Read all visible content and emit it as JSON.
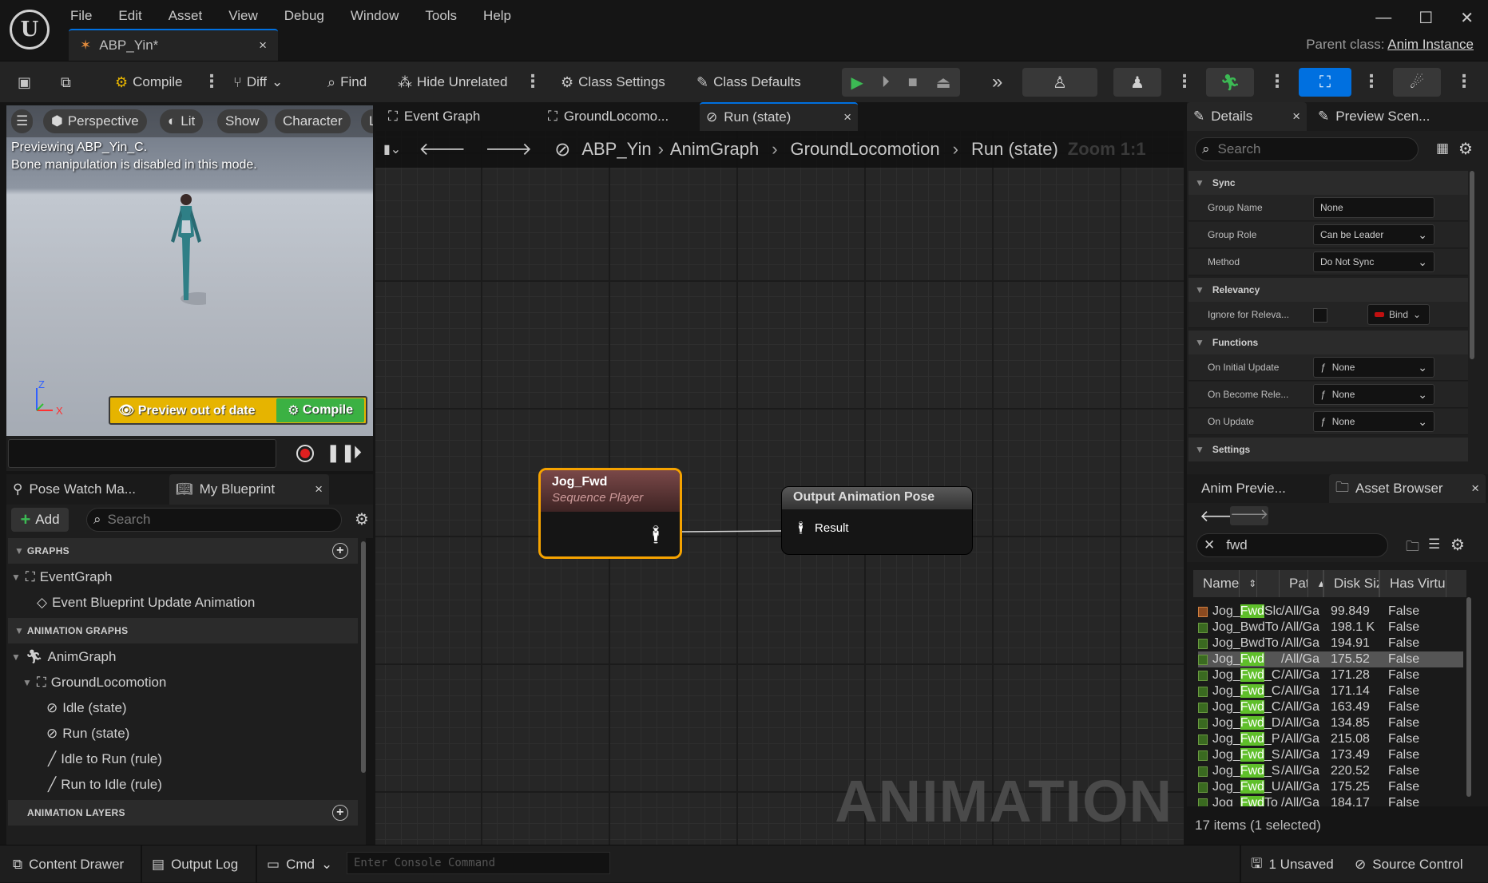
{
  "menu": [
    "File",
    "Edit",
    "Asset",
    "View",
    "Debug",
    "Window",
    "Tools",
    "Help"
  ],
  "doc_tab": {
    "title": "ABP_Yin*",
    "close": "×"
  },
  "window_controls": {
    "minimize": "—",
    "maximize": "☐",
    "close": "✕"
  },
  "parent_class": {
    "label": "Parent class:",
    "value": "Anim Instance"
  },
  "toolbar": {
    "compile": "Compile",
    "diff": "Diff",
    "find": "Find",
    "hide_unrelated": "Hide Unrelated",
    "class_settings": "Class Settings",
    "class_defaults": "Class Defaults"
  },
  "viewport": {
    "buttons": [
      "Perspective",
      "Lit",
      "Show",
      "Character",
      "L"
    ],
    "message_line1": "Previewing ABP_Yin_C.",
    "message_line2": "Bone manipulation is disabled in this mode.",
    "warning": "Preview out of date",
    "compile": "Compile",
    "axis_z": "Z",
    "axis_x": "X"
  },
  "left_panel": {
    "tab_pose_watch": "Pose Watch Ma...",
    "tab_my_blueprint": "My Blueprint",
    "add": "Add",
    "search_placeholder": "Search",
    "sections": {
      "graphs": "GRAPHS",
      "animation_graphs": "ANIMATION GRAPHS",
      "animation_layers": "ANIMATION LAYERS"
    },
    "tree": {
      "event_graph": "EventGraph",
      "event_bp_update": "Event Blueprint Update Animation",
      "anim_graph": "AnimGraph",
      "ground_locomotion": "GroundLocomotion",
      "idle_state": "Idle (state)",
      "run_state": "Run (state)",
      "idle_to_run": "Idle to Run (rule)",
      "run_to_idle": "Run to Idle (rule)"
    }
  },
  "graph": {
    "tabs": [
      "Event Graph",
      "GroundLocomo...",
      "Run (state)"
    ],
    "breadcrumb": [
      "ABP_Yin",
      "AnimGraph",
      "GroundLocomotion",
      "Run (state)"
    ],
    "zoom": "Zoom 1:1",
    "watermark": "ANIMATION",
    "node_player": {
      "title": "Jog_Fwd",
      "subtitle": "Sequence Player"
    },
    "node_output": {
      "title": "Output Animation Pose",
      "pin": "Result"
    }
  },
  "details": {
    "tab_details": "Details",
    "tab_preview": "Preview Scen...",
    "search_placeholder": "Search",
    "sync": {
      "title": "Sync",
      "group_name_label": "Group Name",
      "group_name": "None",
      "group_role_label": "Group Role",
      "group_role": "Can be Leader",
      "method_label": "Method",
      "method": "Do Not Sync"
    },
    "relevancy": {
      "title": "Relevancy",
      "ignore_label": "Ignore for Releva...",
      "bind": "Bind"
    },
    "functions": {
      "title": "Functions",
      "initial_label": "On Initial Update",
      "initial": "None",
      "become_label": "On Become Rele...",
      "become": "None",
      "update_label": "On Update",
      "update": "None"
    },
    "settings": {
      "title": "Settings"
    }
  },
  "asset_browser": {
    "tab_anim_preview": "Anim Previe...",
    "tab_asset_browser": "Asset Browser",
    "search_value": "fwd",
    "columns": [
      "Name",
      "Path",
      "Disk Size",
      "Has Virtu"
    ],
    "rows": [
      {
        "pre": "Jog_",
        "hl": "Fwd",
        "post": "Slo|",
        "path": "/All/Ga",
        "size": "99.849",
        "virt": "False",
        "icon": "orange"
      },
      {
        "pre": "Jog_BwdTo",
        "hl": "",
        "post": "",
        "path": "/All/Ga",
        "size": "198.1 K",
        "virt": "False",
        "icon": "green"
      },
      {
        "pre": "Jog_BwdTo",
        "hl": "",
        "post": "",
        "path": "/All/Ga",
        "size": "194.91",
        "virt": "False",
        "icon": "green"
      },
      {
        "pre": "Jog_",
        "hl": "Fwd",
        "post": "",
        "path": "/All/Ga",
        "size": "175.52",
        "virt": "False",
        "icon": "green",
        "selected": true
      },
      {
        "pre": "Jog_",
        "hl": "Fwd",
        "post": "_C",
        "path": "/All/Ga",
        "size": "171.28",
        "virt": "False",
        "icon": "green"
      },
      {
        "pre": "Jog_",
        "hl": "Fwd",
        "post": "_C",
        "path": "/All/Ga",
        "size": "171.14",
        "virt": "False",
        "icon": "green"
      },
      {
        "pre": "Jog_",
        "hl": "Fwd",
        "post": "_C",
        "path": "/All/Ga",
        "size": "163.49",
        "virt": "False",
        "icon": "green"
      },
      {
        "pre": "Jog_",
        "hl": "Fwd",
        "post": "_D",
        "path": "/All/Ga",
        "size": "134.85",
        "virt": "False",
        "icon": "green"
      },
      {
        "pre": "Jog_",
        "hl": "Fwd",
        "post": "_P",
        "path": "/All/Ga",
        "size": "215.08",
        "virt": "False",
        "icon": "green"
      },
      {
        "pre": "Jog_",
        "hl": "Fwd",
        "post": "_S",
        "path": "/All/Ga",
        "size": "173.49",
        "virt": "False",
        "icon": "green"
      },
      {
        "pre": "Jog_",
        "hl": "Fwd",
        "post": "_S",
        "path": "/All/Ga",
        "size": "220.52",
        "virt": "False",
        "icon": "green"
      },
      {
        "pre": "Jog_",
        "hl": "Fwd",
        "post": "_U",
        "path": "/All/Ga",
        "size": "175.25",
        "virt": "False",
        "icon": "green"
      },
      {
        "pre": "Jog_",
        "hl": "Fwd",
        "post": "To",
        "path": "/All/Ga",
        "size": "184.17",
        "virt": "False",
        "icon": "green"
      }
    ],
    "count": "17 items (1 selected)"
  },
  "statusbar": {
    "content_drawer": "Content Drawer",
    "output_log": "Output Log",
    "cmd": "Cmd",
    "console_placeholder": "Enter Console Command",
    "unsaved": "1 Unsaved",
    "source_control": "Source Control"
  },
  "colors": {
    "accent": "#0070e0",
    "node_border": "#f6a300",
    "compile_green": "#3bb143",
    "warning_yellow": "#e6b400",
    "highlight_green": "#5fbf2a"
  }
}
